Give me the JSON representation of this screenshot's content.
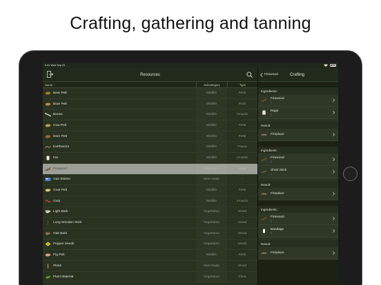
{
  "headline": "Crafting, gathering and tanning",
  "status": {
    "time_date": "9:41  Wed Sep 23"
  },
  "left_nav": {
    "title": "Resources"
  },
  "columns": {
    "name": "Name",
    "subcategory": "Subcategory",
    "type": "Type"
  },
  "resources": [
    {
      "name": "Bear Pelt",
      "sub": "Wildlife",
      "type": "Pelts",
      "icon": "pelt-icon",
      "color": "#a8762e"
    },
    {
      "name": "Boar Pelt",
      "sub": "Wildlife",
      "type": "Pelts",
      "icon": "pelt-icon",
      "color": "#b88a44"
    },
    {
      "name": "Bones",
      "sub": "Wildlife",
      "type": "Innards",
      "icon": "bone-icon",
      "color": "#e0ddd0"
    },
    {
      "name": "Cow Pelt",
      "sub": "Wildlife",
      "type": "Pelts",
      "icon": "pelt-icon",
      "color": "#c49a58"
    },
    {
      "name": "Deer Pelt",
      "sub": "Wildlife",
      "type": "Pelts",
      "icon": "pelt-icon",
      "color": "#9a6a34"
    },
    {
      "name": "Earthworm",
      "sub": "Wildlife",
      "type": "Fauna",
      "icon": "worm-icon",
      "color": "#c87a6e"
    },
    {
      "name": "Fat",
      "sub": "Wildlife",
      "type": "Innards",
      "icon": "fat-icon",
      "color": "#efeee6"
    },
    {
      "name": "Firewood",
      "sub": "Vegetation",
      "type": "Wood",
      "icon": "firewood-icon",
      "color": "#7a5a2e"
    },
    {
      "name": "Gas Station",
      "sub": "Man-made",
      "type": "-",
      "icon": "gas-station-icon",
      "color": "#4a7fc4"
    },
    {
      "name": "Goat Pelt",
      "sub": "Wildlife",
      "type": "Pelts",
      "icon": "pelt-icon",
      "color": "#d8c27a"
    },
    {
      "name": "Guts",
      "sub": "Wildlife",
      "type": "Innards",
      "icon": "guts-icon",
      "color": "#c24a3a"
    },
    {
      "name": "Light Bark",
      "sub": "Vegetation",
      "type": "Wood",
      "icon": "bark-icon",
      "color": "#d9d6c4"
    },
    {
      "name": "Long Wooden Stick",
      "sub": "Vegetation",
      "type": "Wood",
      "icon": "stick-icon",
      "color": "#6b5434"
    },
    {
      "name": "Oak Bark",
      "sub": "Vegetation",
      "type": "Wood",
      "icon": "bark-icon",
      "color": "#8a6a40"
    },
    {
      "name": "Pepper Seeds",
      "sub": "Vegetation",
      "type": "Seeds",
      "icon": "seeds-icon",
      "color": "#d6c33a"
    },
    {
      "name": "Pig Pelt",
      "sub": "Wildlife",
      "type": "Pelts",
      "icon": "pelt-icon",
      "color": "#d89a8a"
    },
    {
      "name": "Plank",
      "sub": "Man-made",
      "type": "Wood",
      "icon": "plank-icon",
      "color": "#b08a54"
    },
    {
      "name": "Plant Material",
      "sub": "Vegetation",
      "type": "Flora",
      "icon": "plant-icon",
      "color": "#6aa03a"
    }
  ],
  "selected_index": 7,
  "right_nav": {
    "back_label": "Firewood",
    "title": "Crafting"
  },
  "recipes": [
    {
      "ingredients_label": "Ingredients:",
      "ingredients": [
        {
          "name": "Firewood",
          "qty": "1"
        },
        {
          "name": "Rags",
          "qty": "1"
        }
      ],
      "result_label": "Result:",
      "result": {
        "name": "Fireplace"
      }
    },
    {
      "ingredients_label": "Ingredients:",
      "ingredients": [
        {
          "name": "Firewood",
          "qty": "1"
        },
        {
          "name": "Short Stick",
          "qty": "1"
        }
      ],
      "result_label": "Result:",
      "result": {
        "name": "Fireplace"
      }
    },
    {
      "ingredients_label": "Ingredients:",
      "ingredients": [
        {
          "name": "Firewood",
          "qty": "1"
        },
        {
          "name": "Bandage",
          "qty": "1"
        }
      ],
      "result_label": "Result:",
      "result": {
        "name": "Fireplace"
      }
    }
  ]
}
